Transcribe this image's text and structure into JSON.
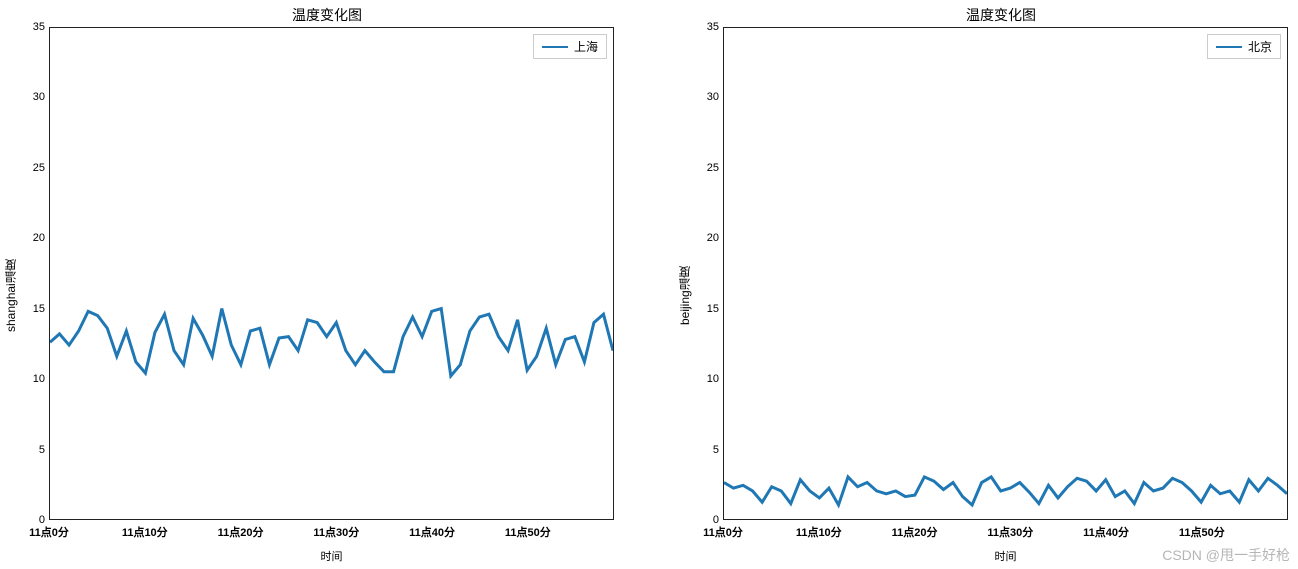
{
  "watermark": "CSDN @甩一手好枪",
  "chart_data": [
    {
      "type": "line",
      "title": "温度变化图",
      "xlabel": "时间",
      "ylabel": "shanghai温度",
      "ylim": [
        0,
        35
      ],
      "yticks": [
        0,
        5,
        10,
        15,
        20,
        25,
        30,
        35
      ],
      "xticks": [
        "11点0分",
        "11点10分",
        "11点20分",
        "11点30分",
        "11点40分",
        "11点50分"
      ],
      "legend": "上海",
      "line_color": "#1f77b4",
      "x": [
        0,
        1,
        2,
        3,
        4,
        5,
        6,
        7,
        8,
        9,
        10,
        11,
        12,
        13,
        14,
        15,
        16,
        17,
        18,
        19,
        20,
        21,
        22,
        23,
        24,
        25,
        26,
        27,
        28,
        29,
        30,
        31,
        32,
        33,
        34,
        35,
        36,
        37,
        38,
        39,
        40,
        41,
        42,
        43,
        44,
        45,
        46,
        47,
        48,
        49,
        50,
        51,
        52,
        53,
        54,
        55,
        56,
        57,
        58,
        59
      ],
      "values": [
        12.6,
        13.2,
        12.4,
        13.4,
        14.8,
        14.5,
        13.6,
        11.6,
        13.4,
        11.2,
        10.4,
        13.3,
        14.6,
        12.0,
        11.0,
        14.3,
        13.1,
        11.6,
        15.0,
        12.4,
        11.0,
        13.4,
        13.6,
        11.0,
        12.9,
        13.0,
        12.0,
        14.2,
        14.0,
        13.0,
        14.0,
        12.0,
        11.0,
        12.0,
        11.2,
        10.5,
        10.5,
        13.0,
        14.4,
        13.0,
        14.8,
        15.0,
        10.2,
        11.0,
        13.4,
        14.4,
        14.6,
        13.0,
        12.0,
        14.2,
        10.6,
        11.6,
        13.6,
        11.0,
        12.8,
        13.0,
        11.2,
        14.0,
        14.6,
        12.0
      ]
    },
    {
      "type": "line",
      "title": "温度变化图",
      "xlabel": "时间",
      "ylabel": "beijing温度",
      "ylim": [
        0,
        35
      ],
      "yticks": [
        0,
        5,
        10,
        15,
        20,
        25,
        30,
        35
      ],
      "xticks": [
        "11点0分",
        "11点10分",
        "11点20分",
        "11点30分",
        "11点40分",
        "11点50分"
      ],
      "legend": "北京",
      "line_color": "#1f77b4",
      "x": [
        0,
        1,
        2,
        3,
        4,
        5,
        6,
        7,
        8,
        9,
        10,
        11,
        12,
        13,
        14,
        15,
        16,
        17,
        18,
        19,
        20,
        21,
        22,
        23,
        24,
        25,
        26,
        27,
        28,
        29,
        30,
        31,
        32,
        33,
        34,
        35,
        36,
        37,
        38,
        39,
        40,
        41,
        42,
        43,
        44,
        45,
        46,
        47,
        48,
        49,
        50,
        51,
        52,
        53,
        54,
        55,
        56,
        57,
        58,
        59
      ],
      "values": [
        2.6,
        2.2,
        2.4,
        2.0,
        1.2,
        2.3,
        2.0,
        1.1,
        2.8,
        2.0,
        1.5,
        2.2,
        1.0,
        3.0,
        2.3,
        2.6,
        2.0,
        1.8,
        2.0,
        1.6,
        1.7,
        3.0,
        2.7,
        2.1,
        2.6,
        1.6,
        1.0,
        2.6,
        3.0,
        2.0,
        2.2,
        2.6,
        1.9,
        1.1,
        2.4,
        1.5,
        2.3,
        2.9,
        2.7,
        2.0,
        2.8,
        1.6,
        2.0,
        1.1,
        2.6,
        2.0,
        2.2,
        2.9,
        2.6,
        2.0,
        1.2,
        2.4,
        1.8,
        2.0,
        1.2,
        2.8,
        2.0,
        2.9,
        2.4,
        1.8
      ]
    }
  ]
}
